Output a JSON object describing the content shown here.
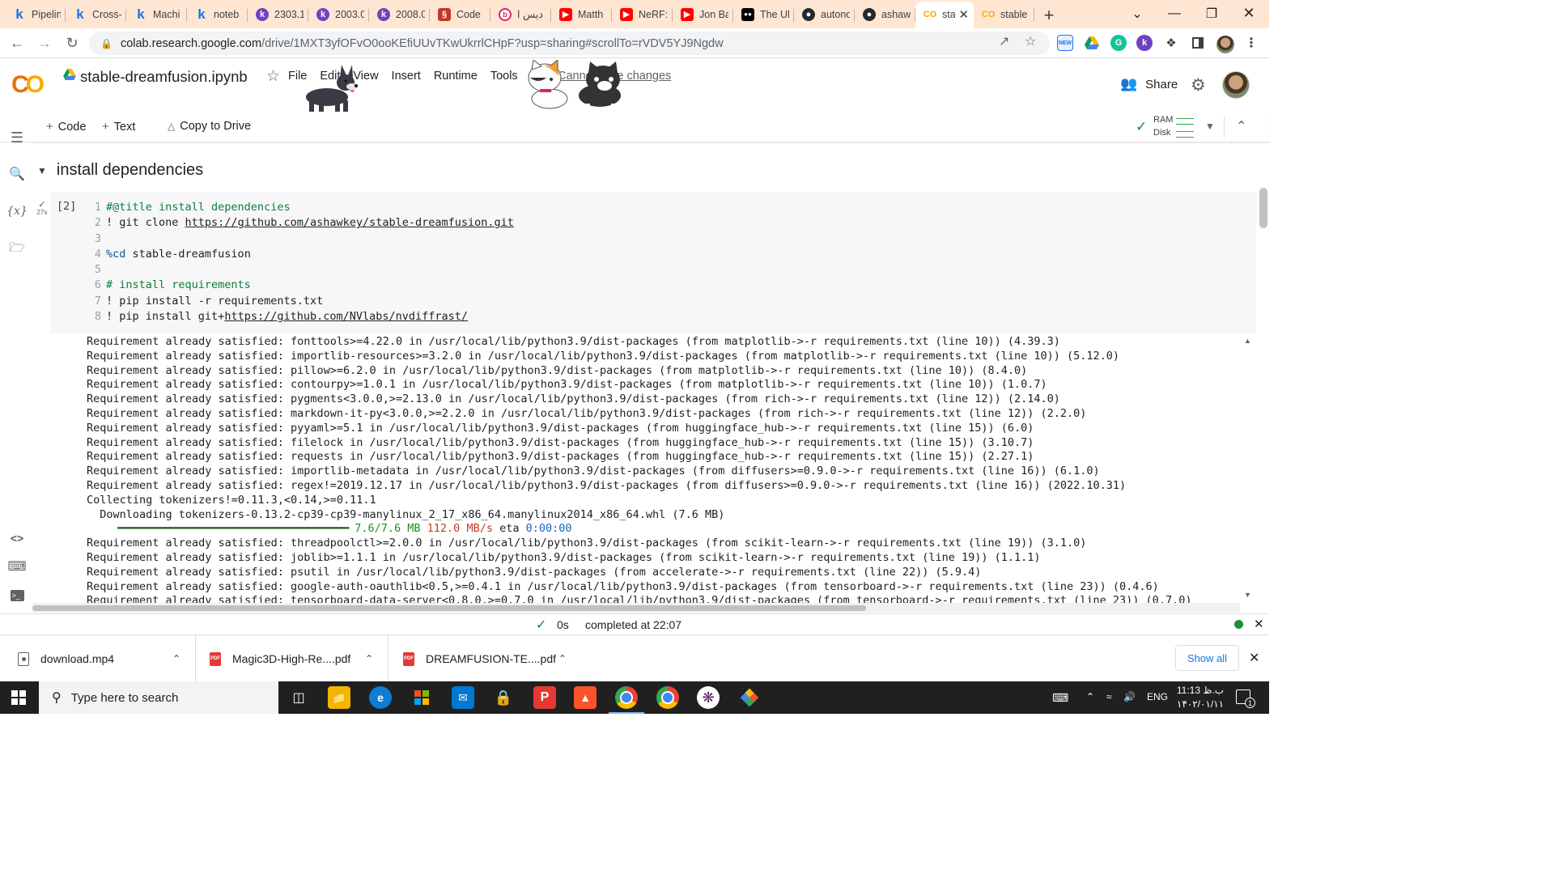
{
  "browser": {
    "tabs": [
      {
        "title": "Pipelin",
        "icon": "kaggle-icon"
      },
      {
        "title": "Cross-",
        "icon": "kaggle-icon"
      },
      {
        "title": "Machi",
        "icon": "kaggle-icon"
      },
      {
        "title": "noteb",
        "icon": "kaggle-icon"
      },
      {
        "title": "2303.1",
        "icon": "kp-icon"
      },
      {
        "title": "2003.0",
        "icon": "kp-icon"
      },
      {
        "title": "2008.0",
        "icon": "kp-icon"
      },
      {
        "title": "Code",
        "icon": "code-icon"
      },
      {
        "title": "دیس ا",
        "icon": "b-icon"
      },
      {
        "title": "Matth",
        "icon": "youtube-icon"
      },
      {
        "title": "NeRF:",
        "icon": "youtube-icon"
      },
      {
        "title": "Jon Ba",
        "icon": "youtube-icon"
      },
      {
        "title": "The Ul",
        "icon": "medium-icon"
      },
      {
        "title": "autono",
        "icon": "github-icon"
      },
      {
        "title": "ashaw",
        "icon": "github-icon"
      },
      {
        "title": "sta",
        "icon": "colab-icon",
        "active": true
      },
      {
        "title": "stable",
        "icon": "colab-icon"
      }
    ],
    "url_host": "colab.research.google.com",
    "url_path": "/drive/1MXT3yfOFvO0ooKEfiUUvTKwUkrrlCHpF?usp=sharing#scrollTo=rVDV5YJ9Ngdw"
  },
  "colab": {
    "notebook_title": "stable-dreamfusion.ipynb",
    "menu": [
      "File",
      "Edit",
      "View",
      "Insert",
      "Runtime",
      "Tools",
      "Help"
    ],
    "save_notice": "Cannot save changes",
    "share_label": "Share",
    "toolbar": {
      "code_label": "Code",
      "text_label": "Text",
      "copy_label": "Copy to Drive",
      "ram_label": "RAM",
      "disk_label": "Disk"
    },
    "section_title": "install dependencies",
    "cell": {
      "exec_count": "[2]",
      "exec_time": "27s",
      "lines": [
        {
          "n": "1",
          "parts": [
            {
              "t": "#@title install dependencies",
              "c": "cmt"
            }
          ]
        },
        {
          "n": "2",
          "parts": [
            {
              "t": "! git clone ",
              "c": "plain"
            },
            {
              "t": "https://github.com/ashawkey/stable-dreamfusion.git",
              "c": "url"
            }
          ]
        },
        {
          "n": "3",
          "parts": []
        },
        {
          "n": "4",
          "parts": [
            {
              "t": "%cd",
              "c": "mag"
            },
            {
              "t": " stable-dreamfusion",
              "c": "plain"
            }
          ]
        },
        {
          "n": "5",
          "parts": []
        },
        {
          "n": "6",
          "parts": [
            {
              "t": "# install requirements",
              "c": "cmt"
            }
          ]
        },
        {
          "n": "7",
          "parts": [
            {
              "t": "! pip install -r requirements.txt",
              "c": "plain"
            }
          ]
        },
        {
          "n": "8",
          "parts": [
            {
              "t": "! pip install git+",
              "c": "plain"
            },
            {
              "t": "https://github.com/NVlabs/nvdiffrast/",
              "c": "url"
            }
          ]
        }
      ]
    },
    "output": [
      "Requirement already satisfied: fonttools>=4.22.0 in /usr/local/lib/python3.9/dist-packages (from matplotlib->-r requirements.txt (line 10)) (4.39.3)",
      "Requirement already satisfied: importlib-resources>=3.2.0 in /usr/local/lib/python3.9/dist-packages (from matplotlib->-r requirements.txt (line 10)) (5.12.0)",
      "Requirement already satisfied: pillow>=6.2.0 in /usr/local/lib/python3.9/dist-packages (from matplotlib->-r requirements.txt (line 10)) (8.4.0)",
      "Requirement already satisfied: contourpy>=1.0.1 in /usr/local/lib/python3.9/dist-packages (from matplotlib->-r requirements.txt (line 10)) (1.0.7)",
      "Requirement already satisfied: pygments<3.0.0,>=2.13.0 in /usr/local/lib/python3.9/dist-packages (from rich->-r requirements.txt (line 12)) (2.14.0)",
      "Requirement already satisfied: markdown-it-py<3.0.0,>=2.2.0 in /usr/local/lib/python3.9/dist-packages (from rich->-r requirements.txt (line 12)) (2.2.0)",
      "Requirement already satisfied: pyyaml>=5.1 in /usr/local/lib/python3.9/dist-packages (from huggingface_hub->-r requirements.txt (line 15)) (6.0)",
      "Requirement already satisfied: filelock in /usr/local/lib/python3.9/dist-packages (from huggingface_hub->-r requirements.txt (line 15)) (3.10.7)",
      "Requirement already satisfied: requests in /usr/local/lib/python3.9/dist-packages (from huggingface_hub->-r requirements.txt (line 15)) (2.27.1)",
      "Requirement already satisfied: importlib-metadata in /usr/local/lib/python3.9/dist-packages (from diffusers>=0.9.0->-r requirements.txt (line 16)) (6.1.0)",
      "Requirement already satisfied: regex!=2019.12.17 in /usr/local/lib/python3.9/dist-packages (from diffusers>=0.9.0->-r requirements.txt (line 16)) (2022.10.31)",
      "Collecting tokenizers!=0.11.3,<0.14,>=0.11.1",
      "  Downloading tokenizers-0.13.2-cp39-cp39-manylinux_2_17_x86_64.manylinux2014_x86_64.whl (7.6 MB)"
    ],
    "progress": {
      "bar": "━━━━━━━━━━━━━━━━━━━━━━━━━━━━━━━━━━━━━━━━",
      "size": "7.6/7.6 MB",
      "speed": "112.0 MB/s",
      "eta_label": "eta",
      "eta": "0:00:00"
    },
    "output_after": [
      "Requirement already satisfied: threadpoolctl>=2.0.0 in /usr/local/lib/python3.9/dist-packages (from scikit-learn->-r requirements.txt (line 19)) (3.1.0)",
      "Requirement already satisfied: joblib>=1.1.1 in /usr/local/lib/python3.9/dist-packages (from scikit-learn->-r requirements.txt (line 19)) (1.1.1)",
      "Requirement already satisfied: psutil in /usr/local/lib/python3.9/dist-packages (from accelerate->-r requirements.txt (line 22)) (5.9.4)",
      "Requirement already satisfied: google-auth-oauthlib<0.5,>=0.4.1 in /usr/local/lib/python3.9/dist-packages (from tensorboard->-r requirements.txt (line 23)) (0.4.6)",
      "Requirement already satisfied: tensorboard-data-server<0.8.0,>=0.7.0 in /usr/local/lib/python3.9/dist-packages (from tensorboard->-r requirements.txt (line 23)) (0.7.0)"
    ],
    "status": {
      "duration": "0s",
      "message": "completed at 22:07"
    }
  },
  "downloads": [
    {
      "name": "download.mp4",
      "type": "video"
    },
    {
      "name": "Magic3D-High-Re....pdf",
      "type": "pdf"
    },
    {
      "name": "DREAMFUSION-TE....pdf",
      "type": "pdf"
    }
  ],
  "show_all_label": "Show all",
  "taskbar": {
    "search_placeholder": "Type here to search",
    "lang": "ENG",
    "time": "11:13 ب.ظ",
    "date": "۱۴۰۲/۰۱/۱۱",
    "notifications": "1"
  }
}
